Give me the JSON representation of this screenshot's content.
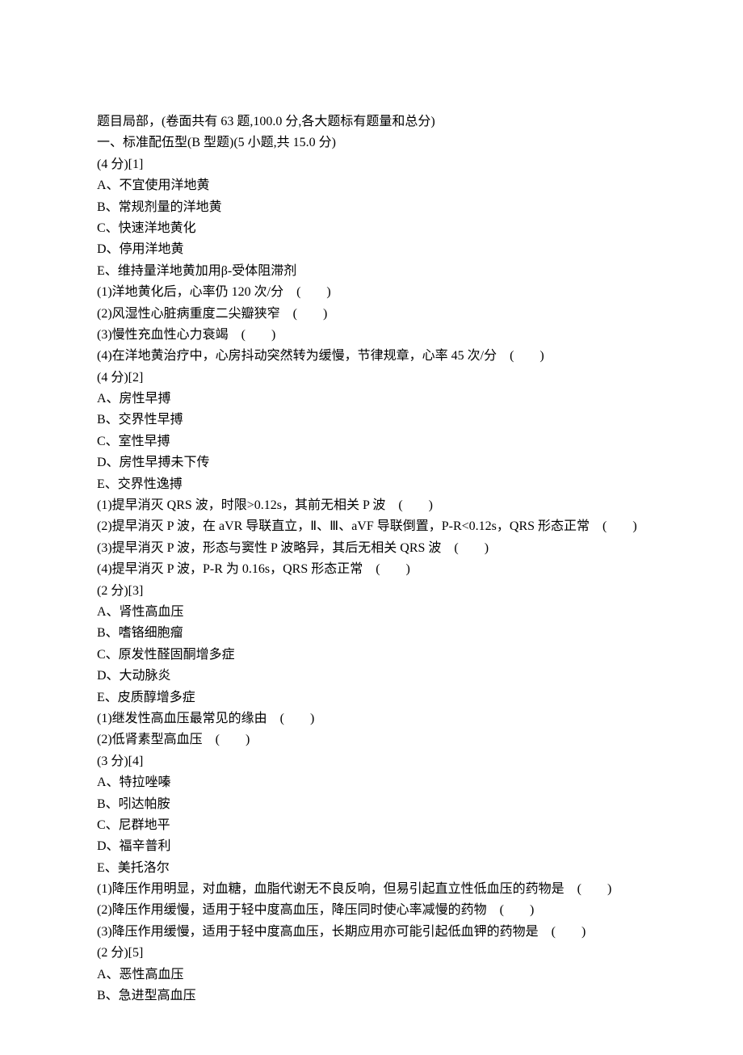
{
  "lines": [
    "题目局部，(卷面共有 63 题,100.0 分,各大题标有题量和总分)",
    "一、标准配伍型(B 型题)(5 小题,共 15.0 分)",
    "(4 分)[1]",
    "A、不宜使用洋地黄",
    "B、常规剂量的洋地黄",
    "C、快速洋地黄化",
    "D、停用洋地黄",
    "E、维持量洋地黄加用β-受体阻滞剂",
    "(1)洋地黄化后，心率仍 120 次/分　(　　)",
    "(2)风湿性心脏病重度二尖瓣狭窄　(　　)",
    "(3)慢性充血性心力衰竭　(　　)",
    "(4)在洋地黄治疗中，心房抖动突然转为缓慢，节律规章，心率 45 次/分　(　　)",
    "(4 分)[2]",
    "A、房性早搏",
    "B、交界性早搏",
    "C、室性早搏",
    "D、房性早搏未下传",
    "E、交界性逸搏",
    "(1)提早消灭 QRS 波，时限>0.12s，其前无相关 P 波　(　　)",
    "(2)提早消灭 P 波，在 aVR 导联直立，Ⅱ、Ⅲ、aVF 导联倒置，P-R<0.12s，QRS 形态正常　(　　)",
    "(3)提早消灭 P 波，形态与窦性 P 波略异，其后无相关 QRS 波　(　　)",
    "(4)提早消灭 P 波，P-R 为 0.16s，QRS 形态正常　(　　)",
    "(2 分)[3]",
    "A、肾性高血压",
    "B、嗜铬细胞瘤",
    "C、原发性醛固酮增多症",
    "D、大动脉炎",
    "E、皮质醇增多症",
    "(1)继发性高血压最常见的缘由　(　　)",
    "(2)低肾素型高血压　(　　)",
    "(3 分)[4]",
    "A、特拉唑嗪",
    "B、吲达帕胺",
    "C、尼群地平",
    "D、福辛普利",
    "E、美托洛尔",
    "(1)降压作用明显，对血糖，血脂代谢无不良反响，但易引起直立性低血压的药物是　(　　)",
    "(2)降压作用缓慢，适用于轻中度高血压，降压同时使心率减慢的药物　(　　)",
    "(3)降压作用缓慢，适用于轻中度高血压，长期应用亦可能引起低血钾的药物是　(　　)",
    "(2 分)[5]",
    "A、恶性高血压",
    "B、急进型高血压"
  ]
}
